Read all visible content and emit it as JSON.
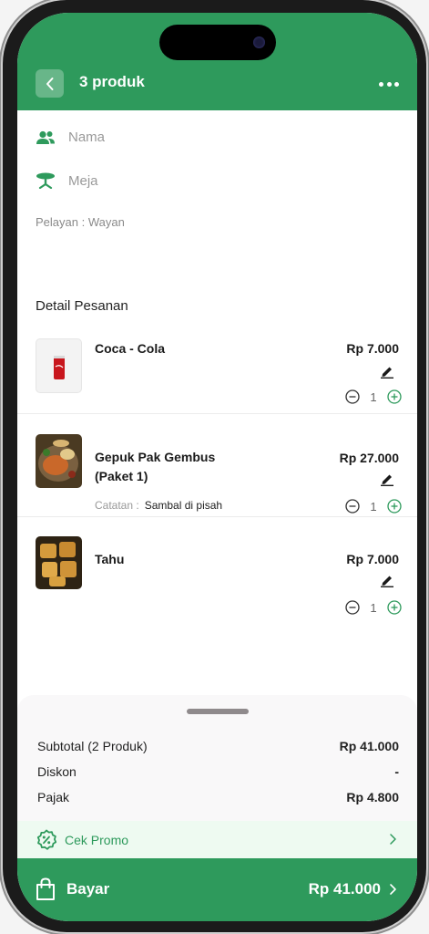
{
  "header": {
    "title": "3 produk"
  },
  "info": {
    "name_placeholder": "Nama",
    "table_placeholder": "Meja",
    "waiter_label": "Pelayan",
    "waiter_name": "Wayan"
  },
  "order": {
    "section_title": "Detail Pesanan",
    "items": [
      {
        "name": "Coca - Cola",
        "price": "Rp 7.000",
        "qty": "1"
      },
      {
        "name": "Gepuk Pak Gembus",
        "name_line2": "(Paket 1)",
        "price": "Rp 27.000",
        "qty": "1",
        "note_label": "Catatan",
        "note_value": "Sambal di pisah"
      },
      {
        "name": "Tahu",
        "price": "Rp 7.000",
        "qty": "1"
      }
    ]
  },
  "summary": {
    "subtotal_label": "Subtotal (2 Produk)",
    "subtotal_value": "Rp 41.000",
    "discount_label": "Diskon",
    "discount_value": "-",
    "tax_label": "Pajak",
    "tax_value": "Rp 4.800"
  },
  "promo": {
    "label": "Cek Promo"
  },
  "pay": {
    "label": "Bayar",
    "total": "Rp 41.000"
  },
  "colors": {
    "brand_green": "#2e9a5c",
    "promo_bg": "#eefaf1"
  }
}
